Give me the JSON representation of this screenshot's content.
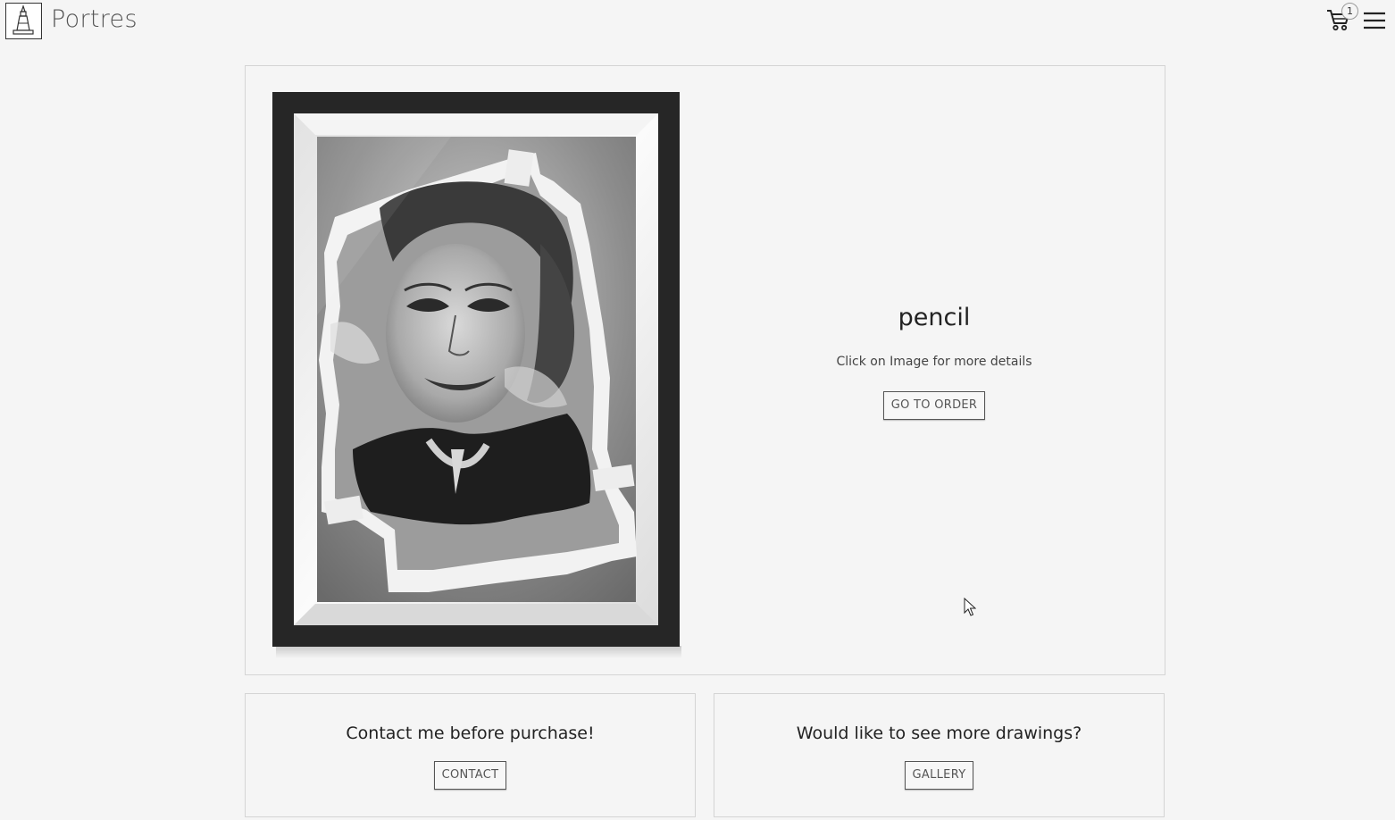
{
  "header": {
    "brand": "Portres",
    "cart_count": "1"
  },
  "product": {
    "title": "pencil",
    "subtitle": "Click on Image for more details",
    "order_button": "GO TO ORDER"
  },
  "contact_card": {
    "title": "Contact me before purchase!",
    "button": "CONTACT"
  },
  "gallery_card": {
    "title": "Would like to see more drawings?",
    "button": "GALLERY"
  },
  "icons": {
    "logo": "tower-logo-icon",
    "cart": "cart-icon",
    "menu": "hamburger-menu-icon"
  }
}
